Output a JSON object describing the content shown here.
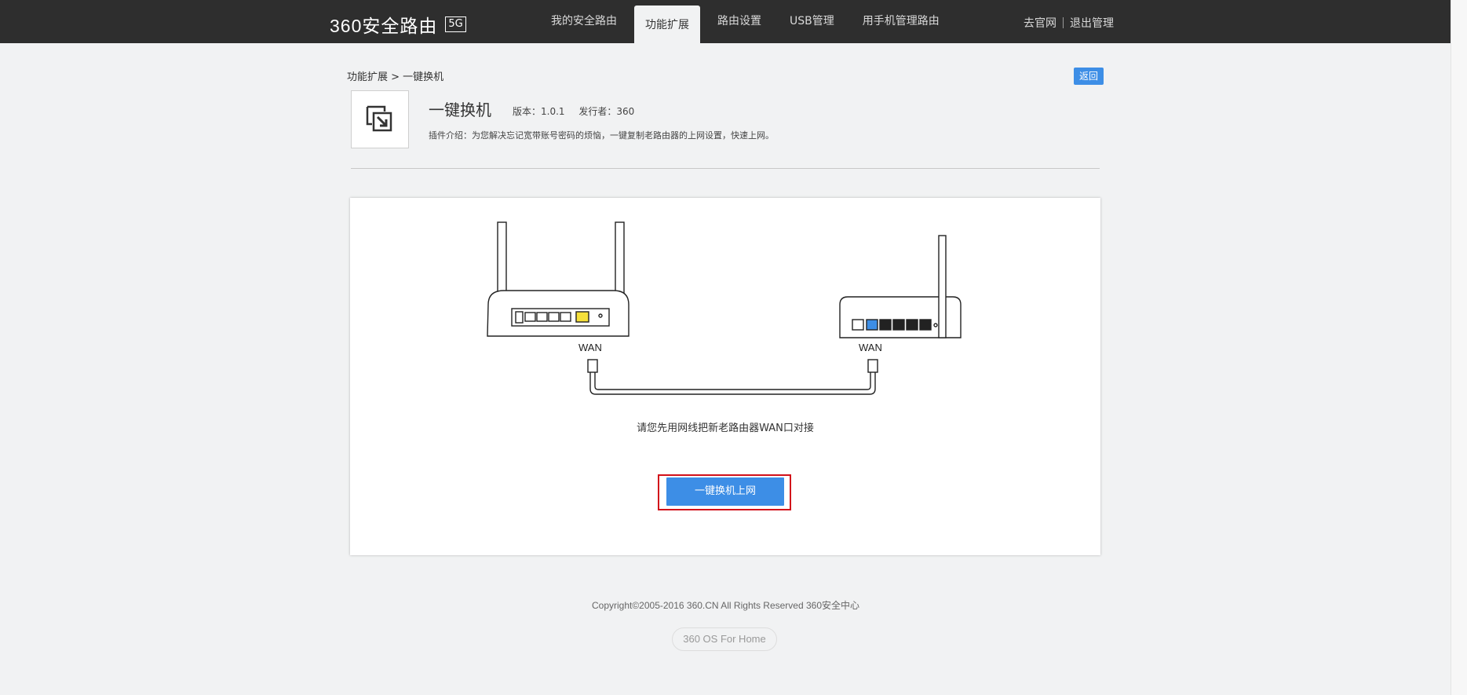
{
  "header": {
    "logo_text": "360安全路由",
    "logo_badge": "5G",
    "nav": [
      {
        "label": "我的安全路由",
        "active": false
      },
      {
        "label": "功能扩展",
        "active": true
      },
      {
        "label": "路由设置",
        "active": false
      },
      {
        "label": "USB管理",
        "active": false
      },
      {
        "label": "用手机管理路由",
        "active": false
      }
    ],
    "links": {
      "official_site": "去官网",
      "logout": "退出管理"
    }
  },
  "breadcrumb": "功能扩展 > 一键换机",
  "back_label": "返回",
  "plugin": {
    "title": "一键换机",
    "version": "版本：1.0.1",
    "publisher": "发行者：360",
    "description": "插件介绍：为您解决忘记宽带账号密码的烦恼，一键复制老路由器的上网设置，快速上网。",
    "icon": "swap-router-icon"
  },
  "diagram": {
    "left_port_label": "WAN",
    "right_port_label": "WAN"
  },
  "instruction": "请您先用网线把新老路由器WAN口对接",
  "action_button": "一键换机上网",
  "footer": {
    "copyright": "Copyright©2005-2016 360.CN All Rights Reserved 360安全中心",
    "os_badge": "360 OS For Home"
  },
  "colors": {
    "topbar": "#2e2e2e",
    "accent": "#3d8ee6",
    "highlight_frame": "#d2111a",
    "wan_port_new": "#f5e03a",
    "wan_port_old": "#3d8ee6"
  }
}
